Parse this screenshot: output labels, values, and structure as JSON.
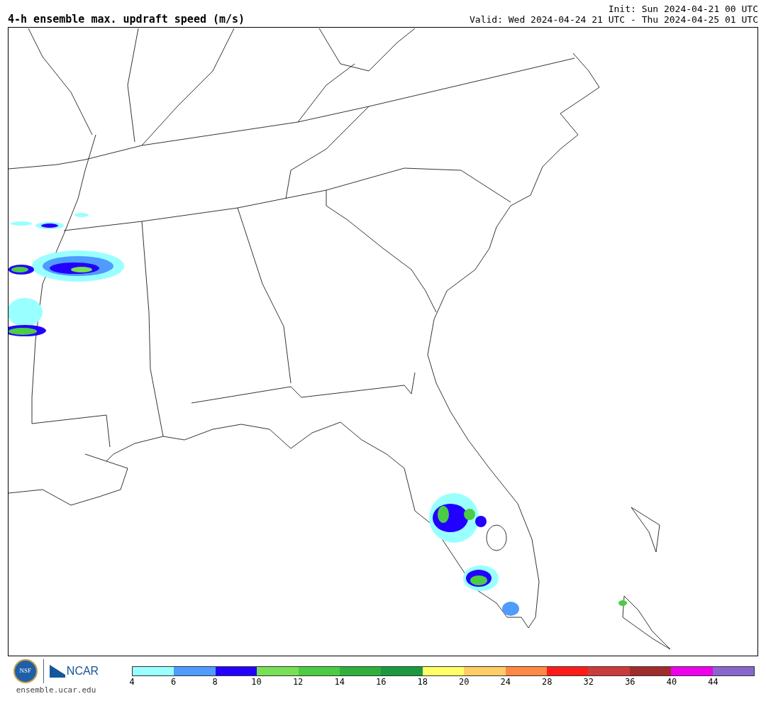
{
  "title": "4-h ensemble max. updraft speed (m/s)",
  "init": "Init: Sun 2024-04-21 00 UTC",
  "valid": "Valid: Wed 2024-04-24 21 UTC - Thu 2024-04-25 01 UTC",
  "logos": {
    "nsf": "NSF",
    "ncar": "NCAR"
  },
  "site": "ensemble.ucar.edu",
  "legend": {
    "bins": [
      {
        "color": "#99ffff",
        "label": "4"
      },
      {
        "color": "#4f9bff",
        "label": "6"
      },
      {
        "color": "#2200ff",
        "label": "8"
      },
      {
        "color": "#77e055",
        "label": "10"
      },
      {
        "color": "#4ccc44",
        "label": "12"
      },
      {
        "color": "#2eb03a",
        "label": "14"
      },
      {
        "color": "#1b9940",
        "label": "16"
      },
      {
        "color": "#ffff66",
        "label": "18"
      },
      {
        "color": "#ffcc66",
        "label": "20"
      },
      {
        "color": "#ff8844",
        "label": "24"
      },
      {
        "color": "#ff1a1a",
        "label": "28"
      },
      {
        "color": "#cc3b3b",
        "label": "32"
      },
      {
        "color": "#a02c2c",
        "label": "36"
      },
      {
        "color": "#ee00ee",
        "label": "40"
      },
      {
        "color": "#8866cc",
        "label": "44"
      }
    ]
  }
}
